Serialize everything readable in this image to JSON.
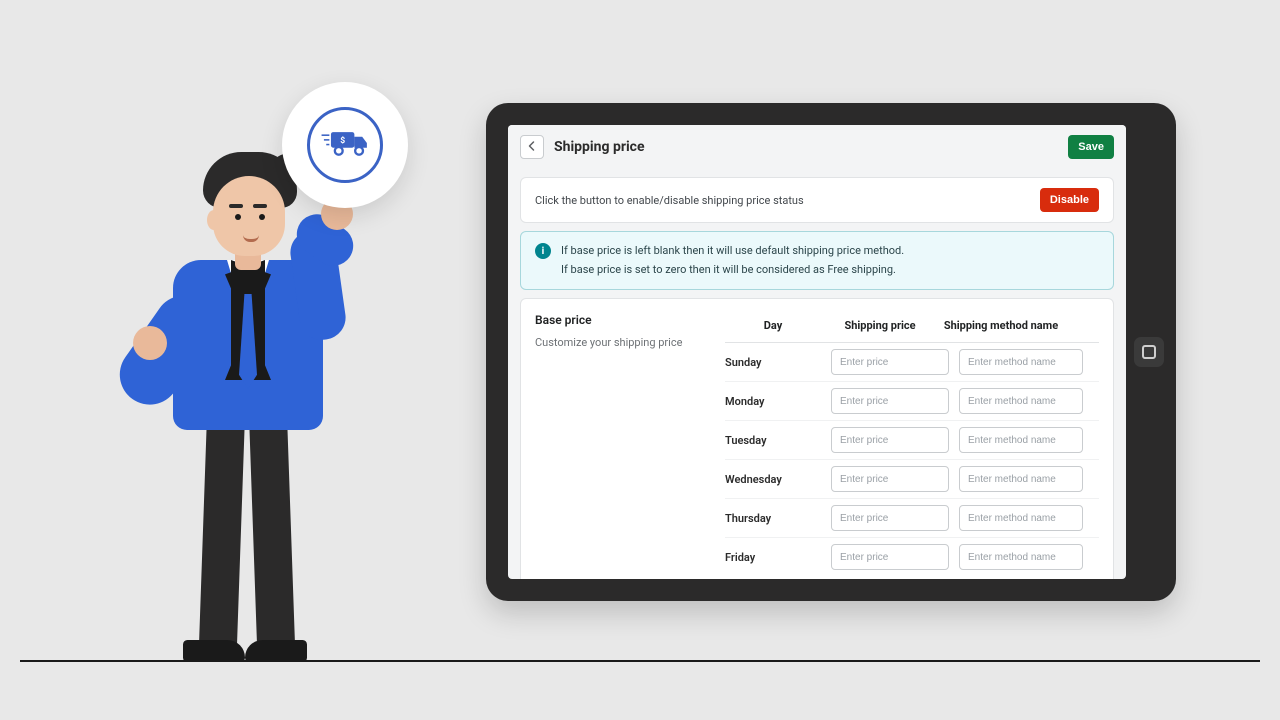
{
  "app_icon": {
    "name": "shipping-truck-icon"
  },
  "header": {
    "title": "Shipping price",
    "save_label": "Save"
  },
  "status_card": {
    "message": "Click the button to enable/disable shipping price status",
    "button_label": "Disable"
  },
  "info_banner": {
    "line1": "If base price is left blank then it will use default shipping price method.",
    "line2": "If base price is set to zero then it will be considered as Free shipping."
  },
  "section": {
    "heading": "Base price",
    "subtext": "Customize your shipping price"
  },
  "table": {
    "headers": {
      "day": "Day",
      "price": "Shipping price",
      "method": "Shipping method name"
    },
    "price_placeholder": "Enter price",
    "method_placeholder": "Enter method name",
    "rows": [
      {
        "day": "Sunday"
      },
      {
        "day": "Monday"
      },
      {
        "day": "Tuesday"
      },
      {
        "day": "Wednesday"
      },
      {
        "day": "Thursday"
      },
      {
        "day": "Friday"
      }
    ]
  }
}
